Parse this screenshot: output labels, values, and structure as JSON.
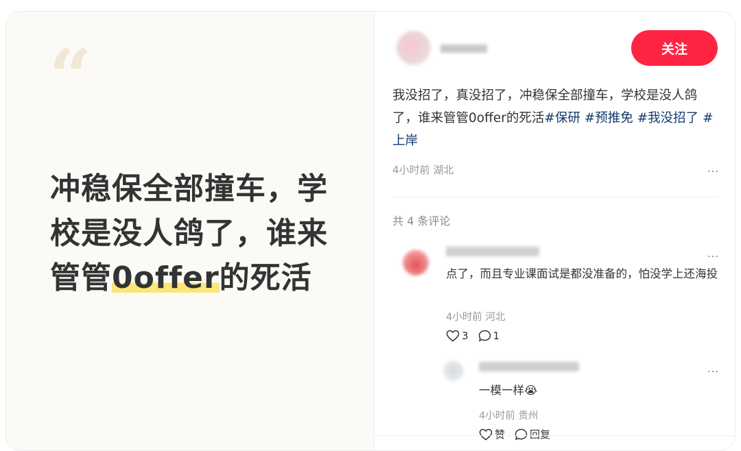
{
  "left_panel": {
    "quote_mark": "“",
    "headline_before": "冲稳保全部撞车，学校是没人鸽了，谁来管管",
    "headline_highlight": "0offer",
    "headline_after": "的死活"
  },
  "post": {
    "follow_label": "关注",
    "text": "我没招了，真没招了，冲稳保全部撞车，学校是没人鸽了，谁来管管0offer的死活",
    "tags": [
      "#保研",
      "#预推免",
      "#我没招了",
      "#上岸"
    ],
    "time": "4小时前",
    "location": "湖北",
    "more_icon": "…"
  },
  "comments_header": "共 4 条评论",
  "comments": [
    {
      "text": "点了，而且专业课面试是都没准备的，怕没学上还海投",
      "time": "4小时前",
      "location": "河北",
      "likes": "3",
      "replies": "1"
    }
  ],
  "reply": {
    "text": "一模一样",
    "emoji": "😭",
    "time": "4小时前",
    "location": "贵州",
    "like_label": "赞",
    "reply_label": "回复"
  },
  "colors": {
    "accent": "#ff2442",
    "tag": "#13386c",
    "highlight": "#fbe67a",
    "left_bg": "#fcfaf6"
  }
}
